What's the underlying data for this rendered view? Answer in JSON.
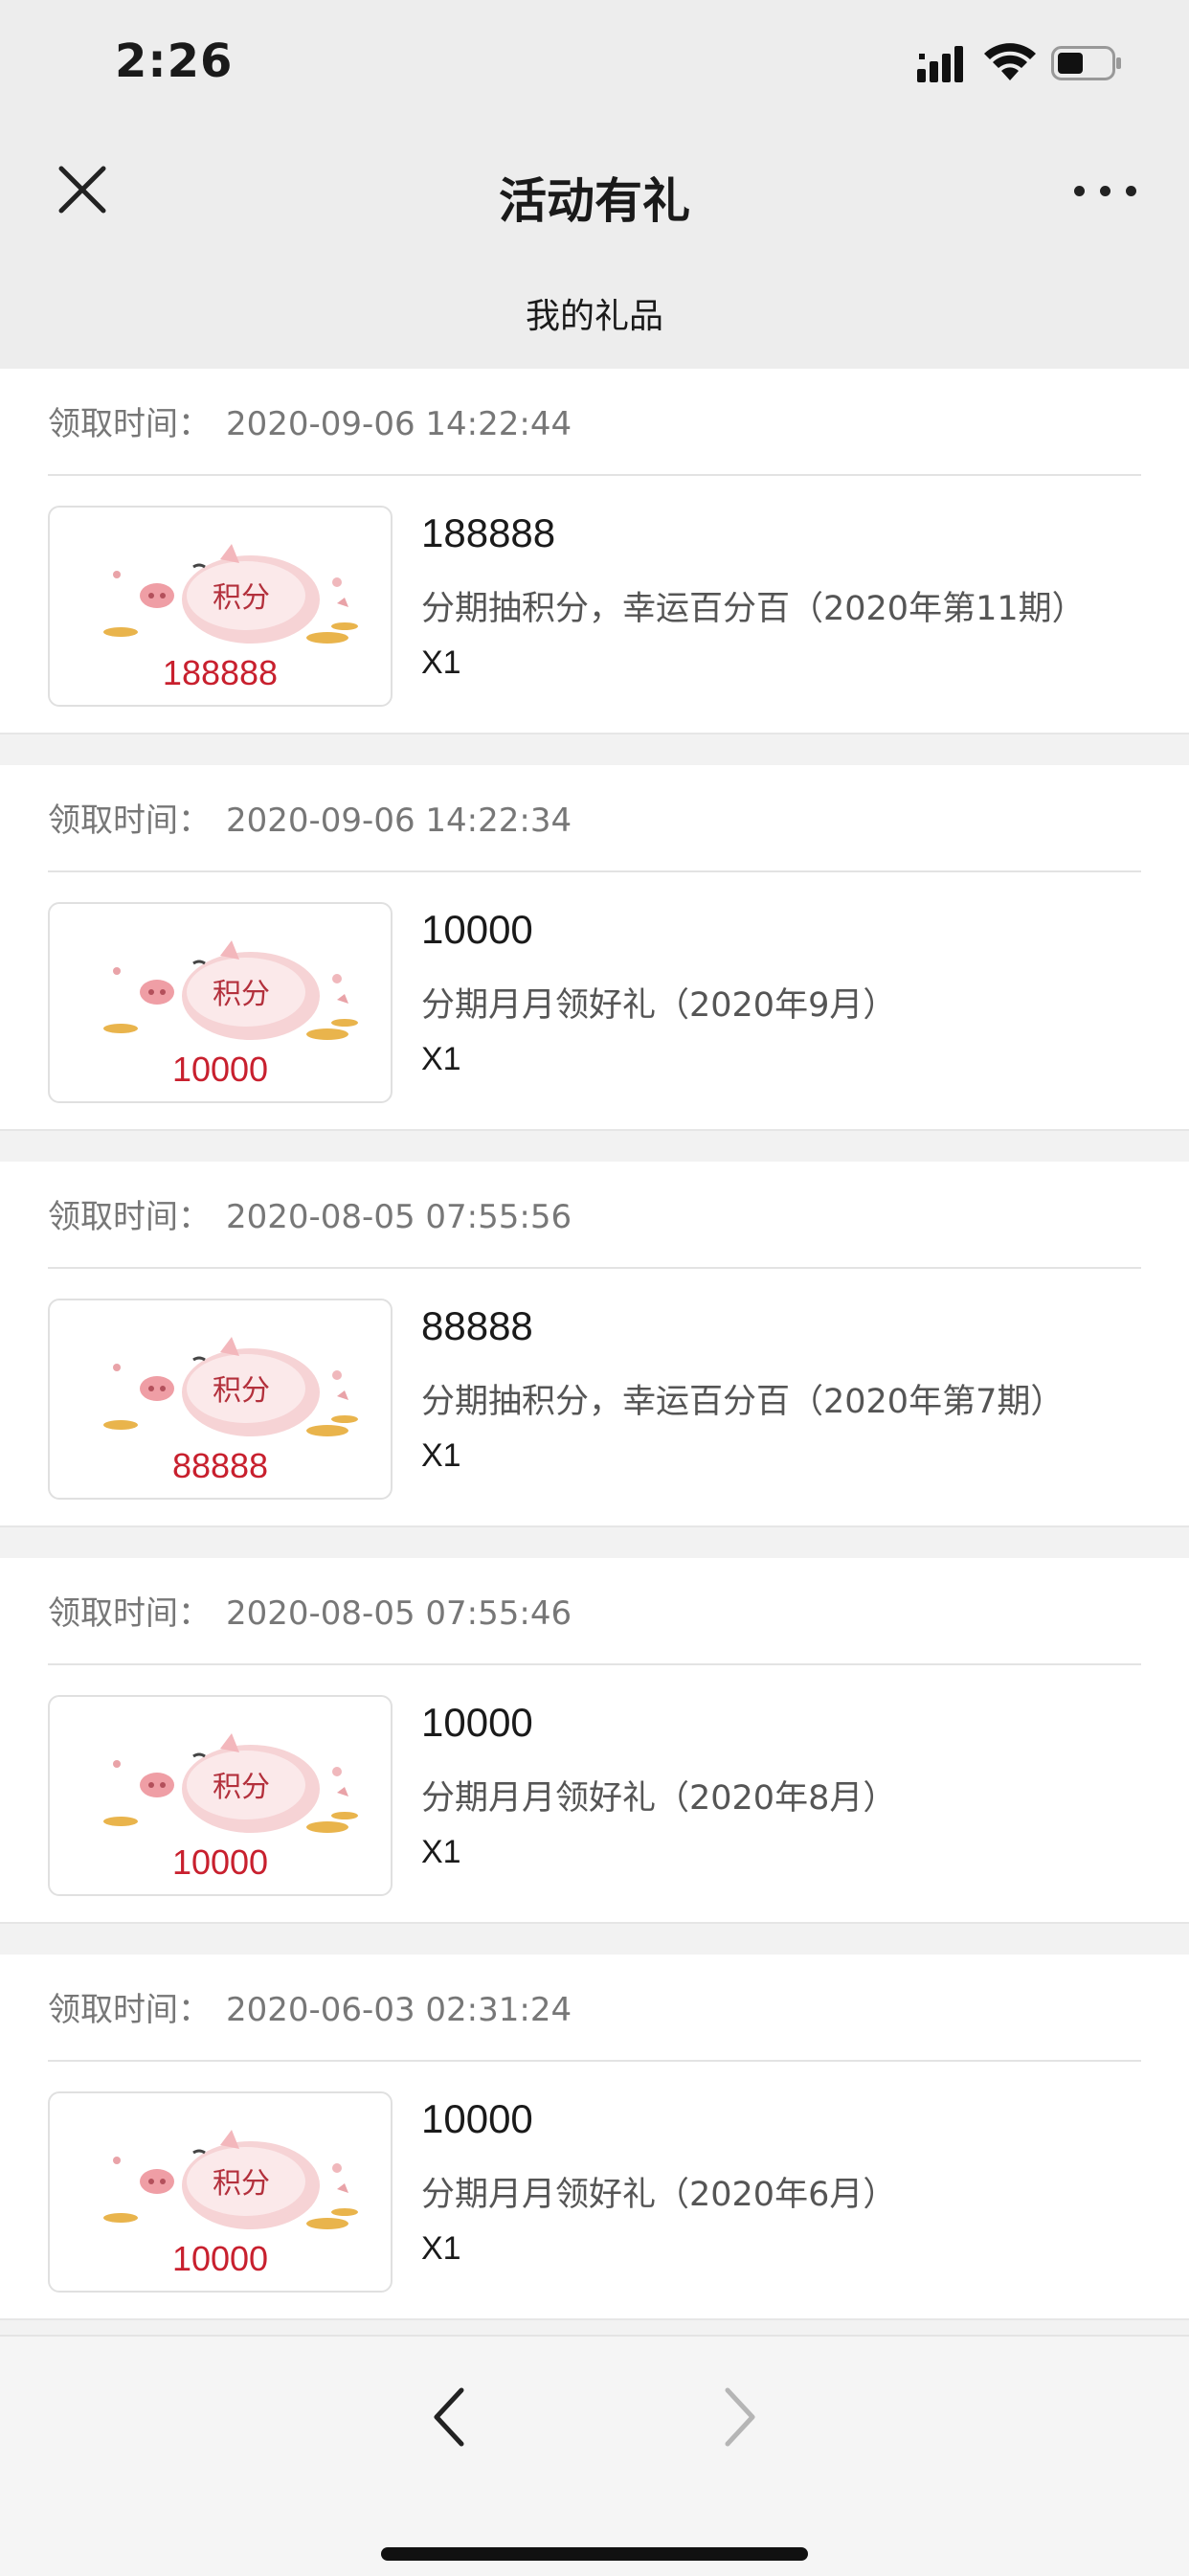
{
  "status_bar": {
    "time": "2:26"
  },
  "nav": {
    "title": "活动有礼"
  },
  "sub_header": {
    "title": "我的礼品"
  },
  "gifts": [
    {
      "time_label": "领取时间：",
      "time": "2020-09-06 14:22:44",
      "badge_label": "积分",
      "thumb_value": "188888",
      "amount": "188888",
      "desc": "分期抽积分，幸运百分百（2020年第11期）",
      "qty": "X1"
    },
    {
      "time_label": "领取时间：",
      "time": "2020-09-06 14:22:34",
      "badge_label": "积分",
      "thumb_value": "10000",
      "amount": "10000",
      "desc": "分期月月领好礼（2020年9月）",
      "qty": "X1"
    },
    {
      "time_label": "领取时间：",
      "time": "2020-08-05 07:55:56",
      "badge_label": "积分",
      "thumb_value": "88888",
      "amount": "88888",
      "desc": "分期抽积分，幸运百分百（2020年第7期）",
      "qty": "X1"
    },
    {
      "time_label": "领取时间：",
      "time": "2020-08-05 07:55:46",
      "badge_label": "积分",
      "thumb_value": "10000",
      "amount": "10000",
      "desc": "分期月月领好礼（2020年8月）",
      "qty": "X1"
    },
    {
      "time_label": "领取时间：",
      "time": "2020-06-03 02:31:24",
      "badge_label": "积分",
      "thumb_value": "10000",
      "amount": "10000",
      "desc": "分期月月领好礼（2020年6月）",
      "qty": "X1"
    }
  ],
  "colors": {
    "accent_red": "#c8202e",
    "pig_pink": "#f3c6c8",
    "coin_gold": "#e9b44c"
  },
  "icons": {
    "close": "close-icon",
    "more": "more-dots-icon",
    "back": "chevron-left-icon",
    "forward": "chevron-right-icon",
    "signal": "cellular-signal-icon",
    "wifi": "wifi-icon",
    "battery": "battery-icon"
  }
}
